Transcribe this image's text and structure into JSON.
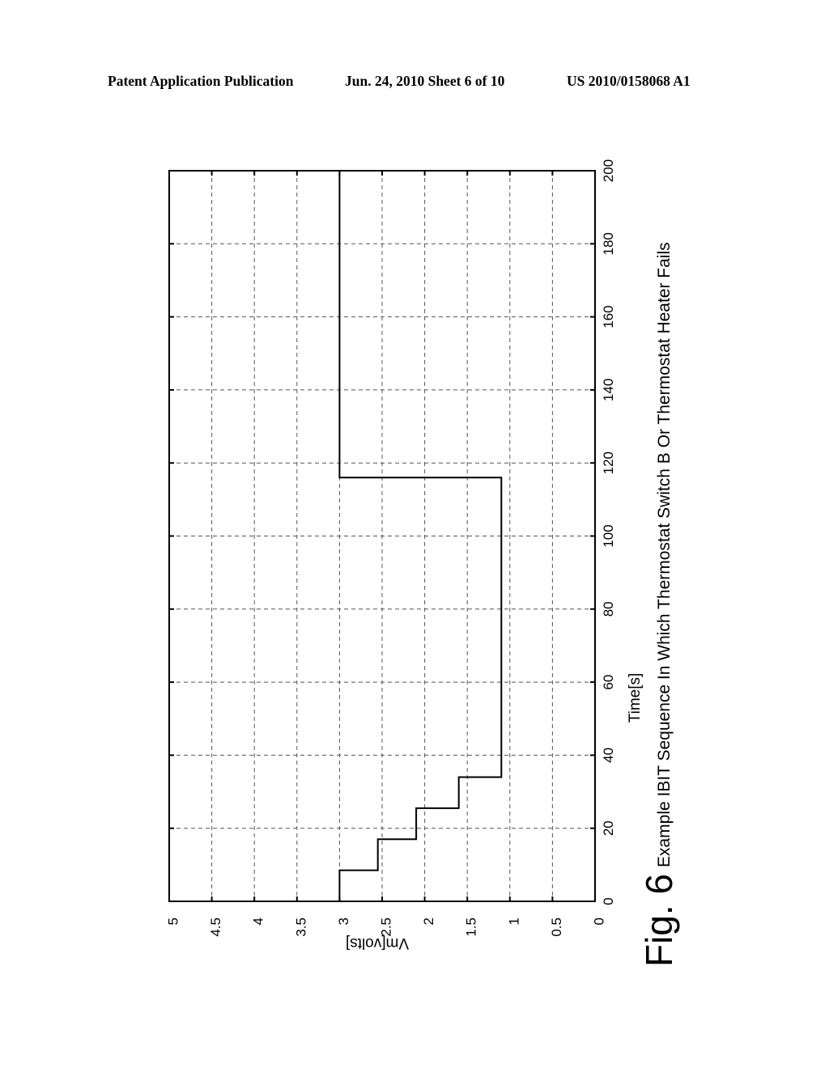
{
  "header": {
    "publication": "Patent Application Publication",
    "date_sheet": "Jun. 24, 2010  Sheet 6 of 10",
    "patent_number": "US 2010/0158068 A1"
  },
  "figure": {
    "label": "Fig. 6",
    "caption": "Example IBIT Sequence In Which Thermostat Switch B Or Thermostat Heater Fails",
    "orientation": "rotated 90 degrees counter-clockwise"
  },
  "chart_data": {
    "type": "line",
    "style": "step",
    "title": "Example IBIT Sequence In Which Thermostat Switch B Or Thermostat Heater Fails",
    "xlabel": "Time[s]",
    "ylabel": "Vm[volts]",
    "xlim": [
      0,
      200
    ],
    "ylim": [
      0,
      5
    ],
    "xticks": [
      "0",
      "20",
      "40",
      "60",
      "80",
      "100",
      "120",
      "140",
      "160",
      "180",
      "200"
    ],
    "xtick_values": [
      0,
      20,
      40,
      60,
      80,
      100,
      120,
      140,
      160,
      180,
      200
    ],
    "yticks": [
      "0",
      "0.5",
      "1",
      "1.5",
      "2",
      "2.5",
      "3",
      "3.5",
      "4",
      "4.5",
      "5"
    ],
    "ytick_values": [
      0,
      0.5,
      1,
      1.5,
      2,
      2.5,
      3,
      3.5,
      4,
      4.5,
      5
    ],
    "grid": true,
    "legend": "none",
    "series": [
      {
        "name": "Vm",
        "x": [
          0,
          8.5,
          8.5,
          17,
          17,
          25.5,
          25.5,
          34,
          34,
          116,
          116,
          200
        ],
        "y": [
          3.0,
          3.0,
          2.55,
          2.55,
          2.1,
          2.1,
          1.6,
          1.6,
          1.1,
          1.1,
          3.0,
          3.0
        ]
      }
    ]
  }
}
